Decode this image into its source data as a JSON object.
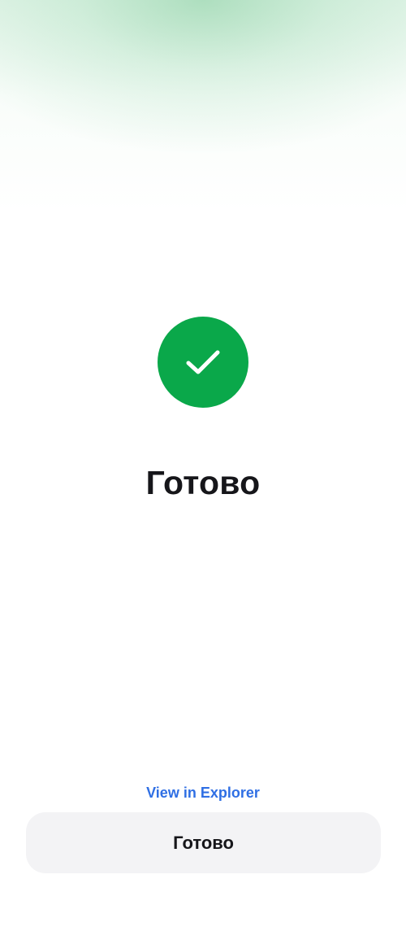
{
  "colors": {
    "success": "#0aa84a",
    "link": "#2f6fe4",
    "button_bg": "#f3f3f5",
    "title_text": "#16161a"
  },
  "status": {
    "icon": "checkmark-icon",
    "title": "Готово"
  },
  "actions": {
    "explorer_link": "View in Explorer",
    "done_button": "Готово"
  }
}
